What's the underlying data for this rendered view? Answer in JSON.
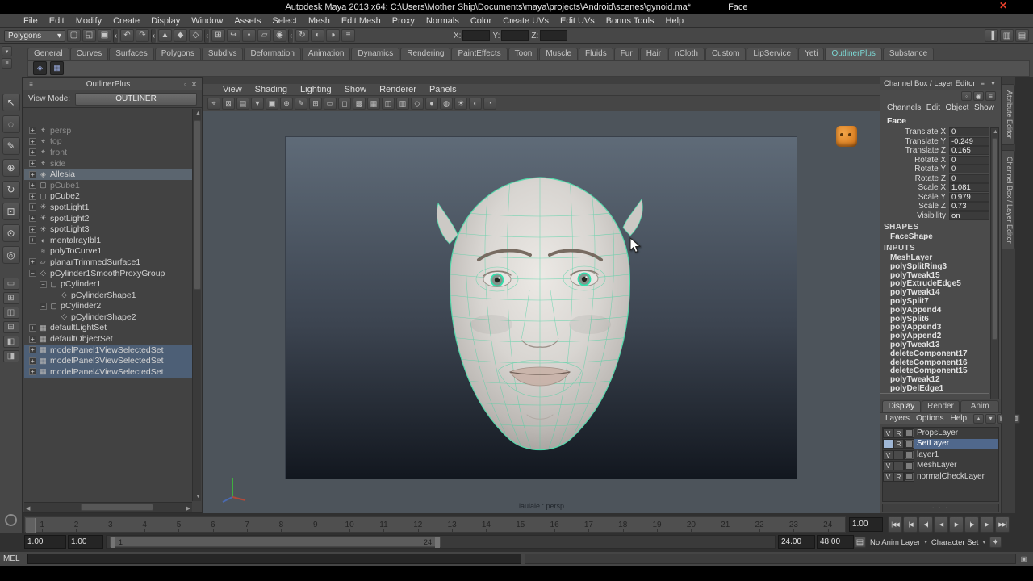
{
  "title_bar": {
    "title": "Autodesk Maya 2013 x64: C:\\Users\\Mother Ship\\Documents\\maya\\projects\\Android\\scenes\\gynoid.ma*",
    "suffix": "Face"
  },
  "glyphs": {
    "close": "✕",
    "dropdown": "▾",
    "up": "▲",
    "down": "▼",
    "left": "◀",
    "right": "▶",
    "outliner_pop": "▫",
    "outliner_close": "✕",
    "key": "✦",
    "anim_layer": "▤",
    "script": "▣",
    "grip": "≡",
    "dots": "· · ·"
  },
  "menu_bar": {
    "items": [
      "File",
      "Edit",
      "Modify",
      "Create",
      "Display",
      "Window",
      "Assets",
      "Select",
      "Mesh",
      "Edit Mesh",
      "Proxy",
      "Normals",
      "Color",
      "Create UVs",
      "Edit UVs",
      "Bonus Tools",
      "Help"
    ]
  },
  "status_line": {
    "menu_set": "Polygons",
    "icons": [
      {
        "name": "file-new-icon",
        "glyph": "▢"
      },
      {
        "name": "file-open-icon",
        "glyph": "◱"
      },
      {
        "name": "file-save-icon",
        "glyph": "▣"
      },
      {
        "name": "group-divider",
        "glyph": "‹",
        "cls": "sep"
      },
      {
        "name": "undo-icon",
        "glyph": "↶"
      },
      {
        "name": "redo-icon",
        "glyph": "↷"
      },
      {
        "name": "group-divider",
        "glyph": "‹",
        "cls": "sep"
      },
      {
        "name": "select-by-hierarchy-icon",
        "glyph": "▲"
      },
      {
        "name": "select-by-object-icon",
        "glyph": "◆"
      },
      {
        "name": "select-by-component-icon",
        "glyph": "◇"
      },
      {
        "name": "group-divider",
        "glyph": "‹",
        "cls": "sep"
      },
      {
        "name": "snap-to-grid-icon",
        "glyph": "⊞"
      },
      {
        "name": "snap-to-curve-icon",
        "glyph": "↪"
      },
      {
        "name": "snap-to-point-icon",
        "glyph": "•"
      },
      {
        "name": "snap-to-plane-icon",
        "glyph": "▱"
      },
      {
        "name": "make-live-icon",
        "glyph": "◉"
      },
      {
        "name": "group-divider",
        "glyph": "‹",
        "cls": "sep"
      },
      {
        "name": "construction-history-icon",
        "glyph": "↻"
      },
      {
        "name": "render-current-frame-icon",
        "glyph": "◐"
      },
      {
        "name": "ipr-render-icon",
        "glyph": "◑"
      },
      {
        "name": "render-settings-icon",
        "glyph": "≡"
      }
    ],
    "coords": [
      {
        "label": "X:",
        "value": ""
      },
      {
        "label": "Y:",
        "value": ""
      },
      {
        "label": "Z:",
        "value": ""
      }
    ],
    "right_icons": [
      {
        "name": "sidebar-toggle-icon",
        "glyph": "▐"
      },
      {
        "name": "attribute-editor-toggle-icon",
        "glyph": "▥"
      },
      {
        "name": "channel-box-toggle-icon",
        "glyph": "▤"
      }
    ]
  },
  "shelf": {
    "nav_icons": [
      {
        "name": "shelf-tab-switch-icon",
        "glyph": "▾"
      },
      {
        "name": "shelf-menu-icon",
        "glyph": "≡"
      }
    ],
    "tabs": [
      {
        "label": "General"
      },
      {
        "label": "Curves"
      },
      {
        "label": "Surfaces"
      },
      {
        "label": "Polygons"
      },
      {
        "label": "Subdivs"
      },
      {
        "label": "Deformation"
      },
      {
        "label": "Animation"
      },
      {
        "label": "Dynamics"
      },
      {
        "label": "Rendering"
      },
      {
        "label": "PaintEffects"
      },
      {
        "label": "Toon"
      },
      {
        "label": "Muscle"
      },
      {
        "label": "Fluids"
      },
      {
        "label": "Fur"
      },
      {
        "label": "Hair"
      },
      {
        "label": "nCloth"
      },
      {
        "label": "Custom"
      },
      {
        "label": "LipService"
      },
      {
        "label": "Yeti"
      },
      {
        "label": "OutlinerPlus",
        "cls": "active"
      },
      {
        "label": "Substance"
      }
    ],
    "items": [
      {
        "name": "shelf-item-outlinerplus",
        "glyph": "◈"
      },
      {
        "name": "shelf-item-panel",
        "glyph": "▦"
      }
    ]
  },
  "toolbox": {
    "tools": [
      {
        "name": "select-tool",
        "glyph": "↖"
      },
      {
        "name": "lasso-select-tool",
        "glyph": "◌"
      },
      {
        "name": "paint-select-tool",
        "glyph": "✎"
      },
      {
        "name": "move-tool",
        "glyph": "⊕"
      },
      {
        "name": "rotate-tool",
        "glyph": "↻"
      },
      {
        "name": "scale-tool",
        "glyph": "⊡"
      },
      {
        "name": "universal-manipulator-tool",
        "glyph": "⊙"
      },
      {
        "name": "last-tool",
        "glyph": "◎"
      }
    ],
    "layouts": [
      {
        "name": "layout-single-pane",
        "glyph": "▭"
      },
      {
        "name": "layout-four-pane",
        "glyph": "⊞"
      },
      {
        "name": "layout-two-pane-side",
        "glyph": "◫"
      },
      {
        "name": "layout-two-pane-stacked",
        "glyph": "⊟"
      },
      {
        "name": "layout-outliner-persp",
        "glyph": "◧"
      },
      {
        "name": "layout-hypershade-persp",
        "glyph": "◨"
      }
    ]
  },
  "outliner": {
    "header": "OutlinerPlus",
    "view_mode_label": "View Mode:",
    "view_mode_value": "OUTLINER",
    "items": [
      {
        "name": "persp",
        "icon": "⌖",
        "cls": "dim",
        "indent": 0,
        "exp": "+"
      },
      {
        "name": "top",
        "icon": "⌖",
        "cls": "dim",
        "indent": 0,
        "exp": "+"
      },
      {
        "name": "front",
        "icon": "⌖",
        "cls": "dim",
        "indent": 0,
        "exp": "+"
      },
      {
        "name": "side",
        "icon": "⌖",
        "cls": "dim",
        "indent": 0,
        "exp": "+"
      },
      {
        "name": "Allesia",
        "icon": "◈",
        "cls": "selected",
        "indent": 0,
        "exp": "+"
      },
      {
        "name": "pCube1",
        "icon": "▢",
        "cls": "dim",
        "indent": 0,
        "exp": "+"
      },
      {
        "name": "pCube2",
        "icon": "▢",
        "indent": 0,
        "exp": "+"
      },
      {
        "name": "spotLight1",
        "icon": "☀",
        "indent": 0,
        "exp": "+"
      },
      {
        "name": "spotLight2",
        "icon": "☀",
        "indent": 0,
        "exp": "+"
      },
      {
        "name": "spotLight3",
        "icon": "☀",
        "indent": 0,
        "exp": "+"
      },
      {
        "name": "mentalrayIbl1",
        "icon": "◐",
        "indent": 0,
        "exp": "+"
      },
      {
        "name": "polyToCurve1",
        "icon": "≈",
        "indent": 0,
        "exp": ""
      },
      {
        "name": "planarTrimmedSurface1",
        "icon": "▱",
        "indent": 0,
        "exp": "+"
      },
      {
        "name": "pCylinder1SmoothProxyGroup",
        "icon": "◇",
        "indent": 0,
        "exp": "−"
      },
      {
        "name": "pCylinder1",
        "icon": "▢",
        "indent": 1,
        "exp": "−"
      },
      {
        "name": "pCylinderShape1",
        "icon": "◇",
        "indent": 2,
        "exp": ""
      },
      {
        "name": "pCylinder2",
        "icon": "▢",
        "indent": 1,
        "exp": "−"
      },
      {
        "name": "pCylinderShape2",
        "icon": "◇",
        "indent": 2,
        "exp": ""
      },
      {
        "name": "defaultLightSet",
        "icon": "▦",
        "indent": 0,
        "exp": "+"
      },
      {
        "name": "defaultObjectSet",
        "icon": "▦",
        "indent": 0,
        "exp": "+"
      },
      {
        "name": "modelPanel1ViewSelectedSet",
        "icon": "▦",
        "cls": "sel-blue",
        "indent": 0,
        "exp": "+"
      },
      {
        "name": "modelPanel3ViewSelectedSet",
        "icon": "▦",
        "cls": "sel-blue",
        "indent": 0,
        "exp": "+"
      },
      {
        "name": "modelPanel4ViewSelectedSet",
        "icon": "▦",
        "cls": "sel-blue",
        "indent": 0,
        "exp": "+"
      }
    ]
  },
  "viewport": {
    "menus": [
      "View",
      "Shading",
      "Lighting",
      "Show",
      "Renderer",
      "Panels"
    ],
    "toolbar_icons": [
      {
        "name": "select-camera-icon",
        "glyph": "⌖"
      },
      {
        "name": "lock-camera-icon",
        "glyph": "⊠"
      },
      {
        "name": "camera-attributes-icon",
        "glyph": "▤"
      },
      {
        "name": "bookmarks-icon",
        "glyph": "▼"
      },
      {
        "name": "image-plane-icon",
        "glyph": "▣"
      },
      {
        "name": "2d-pan-zoom-icon",
        "glyph": "⊕"
      },
      {
        "name": "grease-pencil-icon",
        "glyph": "✎"
      },
      {
        "name": "grid-icon",
        "glyph": "⊞"
      },
      {
        "name": "film-gate-icon",
        "glyph": "▭"
      },
      {
        "name": "resolution-gate-icon",
        "glyph": "◻"
      },
      {
        "name": "gate-mask-icon",
        "glyph": "▩"
      },
      {
        "name": "field-chart-icon",
        "glyph": "▦"
      },
      {
        "name": "safe-action-icon",
        "glyph": "◫"
      },
      {
        "name": "safe-title-icon",
        "glyph": "▥"
      },
      {
        "name": "wireframe-icon",
        "glyph": "◇"
      },
      {
        "name": "shaded-icon",
        "glyph": "●"
      },
      {
        "name": "textured-icon",
        "glyph": "◍"
      },
      {
        "name": "lights-icon",
        "glyph": "☀"
      },
      {
        "name": "shadows-icon",
        "glyph": "◐"
      },
      {
        "name": "xray-icon",
        "glyph": "◔"
      }
    ],
    "camera_label": "laulale : persp"
  },
  "channel_box": {
    "header": "Channel Box / Layer Editor",
    "header_icons": [
      {
        "name": "channelbox-grip-icon",
        "glyph": "≡"
      },
      {
        "name": "channelbox-collapse-icon",
        "glyph": "▾"
      }
    ],
    "strip_icons": [
      {
        "name": "manip-off-icon",
        "glyph": "◦"
      },
      {
        "name": "manip-on-icon",
        "glyph": "◉"
      },
      {
        "name": "speed-slider-icon",
        "glyph": "≡"
      }
    ],
    "menus": [
      "Channels",
      "Edit",
      "Object",
      "Show"
    ],
    "object_name": "Face",
    "channels": [
      {
        "label": "Translate X",
        "value": "0"
      },
      {
        "label": "Translate Y",
        "value": "-0.249"
      },
      {
        "label": "Translate Z",
        "value": "0.165"
      },
      {
        "label": "Rotate X",
        "value": "0"
      },
      {
        "label": "Rotate Y",
        "value": "0"
      },
      {
        "label": "Rotate Z",
        "value": "0"
      },
      {
        "label": "Scale X",
        "value": "1.081"
      },
      {
        "label": "Scale Y",
        "value": "0.979"
      },
      {
        "label": "Scale Z",
        "value": "0.73"
      },
      {
        "label": "Visibility",
        "value": "on"
      }
    ],
    "shapes_header": "SHAPES",
    "shape_name": "FaceShape",
    "inputs_header": "INPUTS",
    "inputs": [
      "MeshLayer",
      "polySplitRing3",
      "polyTweak15",
      "polyExtrudeEdge5",
      "polyTweak14",
      "polySplit7",
      "polyAppend4",
      "polySplit6",
      "polyAppend3",
      "polyAppend2",
      "polyTweak13",
      "deleteComponent17",
      "deleteComponent16",
      "deleteComponent15",
      "polyTweak12",
      "polyDelEdge1"
    ]
  },
  "layer_editor": {
    "tabs": [
      {
        "label": "Display",
        "cls": "active"
      },
      {
        "label": "Render"
      },
      {
        "label": "Anim"
      }
    ],
    "menus": [
      "Layers",
      "Options",
      "Help"
    ],
    "menu_icons": [
      {
        "name": "move-layer-up-icon",
        "glyph": "▴"
      },
      {
        "name": "move-layer-down-icon",
        "glyph": "▾"
      },
      {
        "name": "new-empty-layer-icon",
        "glyph": "▤"
      },
      {
        "name": "new-layer-from-selected-icon",
        "glyph": "▥"
      }
    ],
    "layers": [
      {
        "v": "V",
        "r": "R",
        "name": "PropsLayer"
      },
      {
        "v": "",
        "r": "R",
        "name": "SetLayer",
        "cls": "current"
      },
      {
        "v": "V",
        "r": "",
        "name": "layer1"
      },
      {
        "v": "V",
        "r": "",
        "name": "MeshLayer"
      },
      {
        "v": "V",
        "r": "R",
        "name": "normalCheckLayer"
      }
    ]
  },
  "side_tabs": [
    {
      "name": "tab-attribute-editor",
      "label": "Attribute Editor"
    },
    {
      "name": "tab-channel-box-layer-editor",
      "label": "Channel Box / Layer Editor"
    }
  ],
  "timeline": {
    "frames": [
      "1",
      "2",
      "3",
      "4",
      "5",
      "6",
      "7",
      "8",
      "9",
      "10",
      "11",
      "12",
      "13",
      "14",
      "15",
      "16",
      "17",
      "18",
      "19",
      "20",
      "21",
      "22",
      "23",
      "24"
    ],
    "current": "1.00",
    "playback": [
      {
        "name": "go-to-start-button",
        "glyph": "|◀◀"
      },
      {
        "name": "step-back-frame-button",
        "glyph": "|◀"
      },
      {
        "name": "step-back-key-button",
        "glyph": "◀|"
      },
      {
        "name": "play-backwards-button",
        "glyph": "◀"
      },
      {
        "name": "play-forwards-button",
        "glyph": "▶"
      },
      {
        "name": "step-forward-key-button",
        "glyph": "|▶"
      },
      {
        "name": "step-forward-frame-button",
        "glyph": "▶|"
      },
      {
        "name": "go-to-end-button",
        "glyph": "▶▶|"
      }
    ]
  },
  "range_slider": {
    "anim_start": "1.00",
    "playback_start": "1.00",
    "bar_start": "1",
    "bar_end": "24",
    "playback_end": "24.00",
    "anim_end": "48.00",
    "anim_layer_label": "No Anim Layer",
    "character_set_label": "Character Set"
  },
  "command_line": {
    "label": "MEL"
  }
}
